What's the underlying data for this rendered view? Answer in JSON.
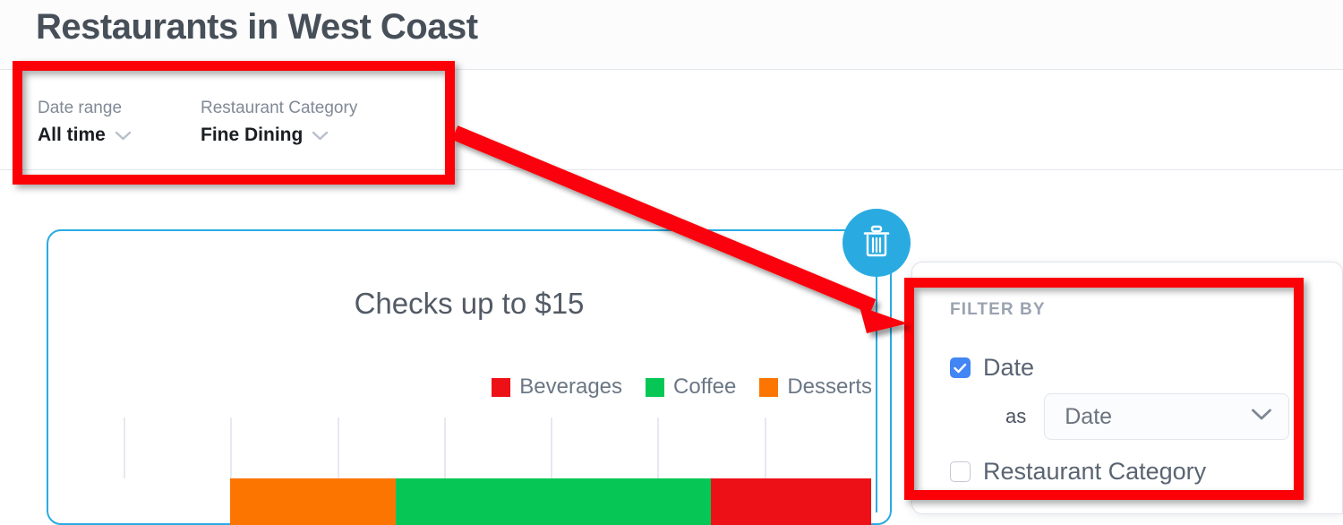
{
  "header": {
    "title": "Restaurants in West Coast"
  },
  "filter_bar": {
    "controls": [
      {
        "label": "Date range",
        "value": "All time",
        "chevron_icon": "chevron-down-icon"
      },
      {
        "label": "Restaurant Category",
        "value": "Fine Dining",
        "chevron_icon": "chevron-down-icon"
      }
    ]
  },
  "chart_card": {
    "delete_button_icon": "trash-icon",
    "border_color": "#29abe2"
  },
  "chart_data": {
    "type": "bar",
    "orientation": "horizontal",
    "stacked": true,
    "title": "Checks up to $15",
    "xlabel": "",
    "ylabel": "",
    "categories": [
      "Checks up to $15"
    ],
    "series": [
      {
        "name": "Desserts",
        "color": "#fb7500",
        "values": [
          1.55
        ]
      },
      {
        "name": "Coffee",
        "color": "#06c755",
        "values": [
          2.95
        ]
      },
      {
        "name": "Beverages",
        "color": "#ed1117",
        "values": [
          1.85
        ]
      }
    ],
    "legend": [
      {
        "label": "Beverages",
        "color": "#ed1117"
      },
      {
        "label": "Coffee",
        "color": "#06c755"
      },
      {
        "label": "Desserts",
        "color": "#fb7500"
      }
    ],
    "legend_position": "top-right",
    "grid": true,
    "gridline_count": 7,
    "xlim": [
      0,
      7
    ]
  },
  "filter_popover": {
    "heading": "FILTER BY",
    "rows": [
      {
        "label": "Date",
        "checked": true
      },
      {
        "label": "Restaurant Category",
        "checked": false
      }
    ],
    "as_label": "as",
    "as_value": "Date",
    "as_chevron_icon": "chevron-down-icon",
    "checked_color": "#4285f4"
  },
  "annotations": {
    "highlight_color": "#fb0007",
    "boxes": [
      "filter-bar-highlight",
      "filter-popover-highlight"
    ],
    "arrow": "filter-bar-to-popover-arrow"
  }
}
